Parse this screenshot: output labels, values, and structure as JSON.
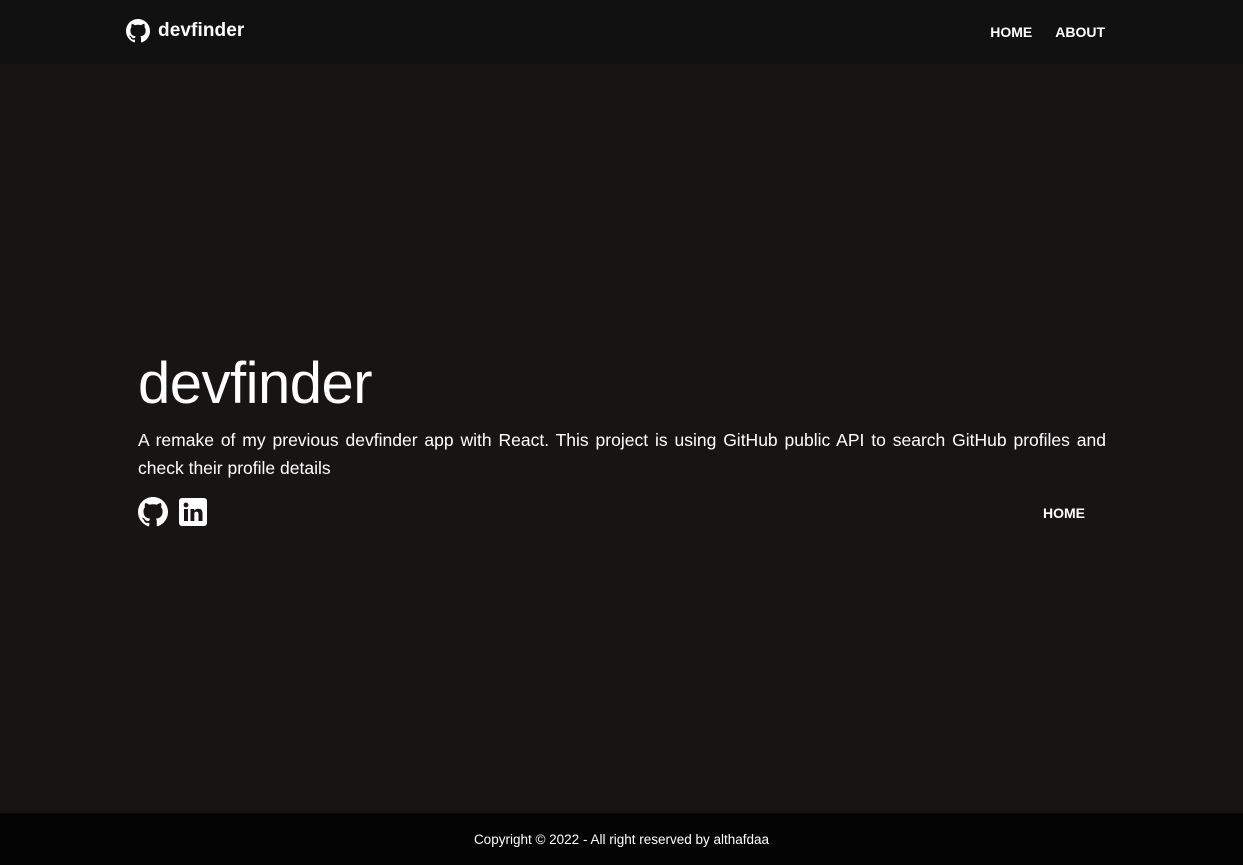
{
  "navbar": {
    "brand": {
      "label": "devfinder",
      "icon": "github-icon"
    },
    "links": [
      {
        "label": "HOME"
      },
      {
        "label": "ABOUT"
      }
    ]
  },
  "about": {
    "title": "devfinder",
    "description": "A remake of my previous devfinder app with React. This project is using GitHub public API to search GitHub profiles and check their profile details",
    "social_links": [
      {
        "icon": "github-icon"
      },
      {
        "icon": "linkedin-icon"
      }
    ],
    "home_link": "HOME"
  },
  "footer": {
    "text": "Copyright © 2022 - All right reserved by althafdaa"
  },
  "colors": {
    "page_background": "#171414",
    "navbar_background": "#121111",
    "footer_background": "#040404",
    "text": "#ffffff"
  }
}
